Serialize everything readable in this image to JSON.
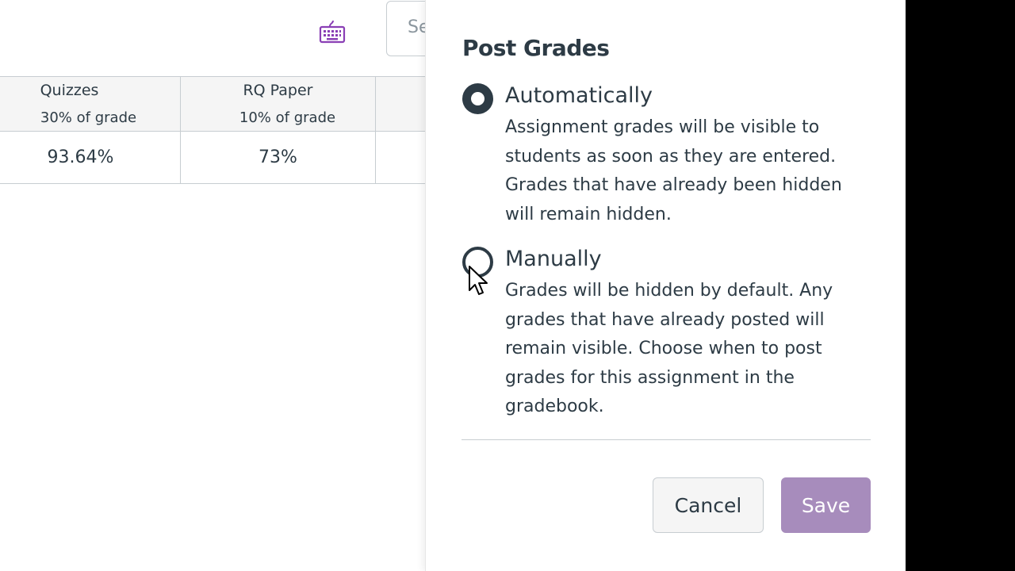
{
  "gradebook": {
    "search": {
      "placeholder": "Search"
    },
    "columns": [
      {
        "name": "Quizzes",
        "weight": "30% of grade",
        "value": "93.64%"
      },
      {
        "name": "RQ Paper",
        "weight": "10% of grade",
        "value": "73%"
      }
    ]
  },
  "tray": {
    "title": "Post Grades",
    "options": [
      {
        "label": "Automatically",
        "selected": true,
        "description": "Assignment grades will be visible to students as soon as they are entered. Grades that have already been hidden will remain hidden."
      },
      {
        "label": "Manually",
        "selected": false,
        "description": "Grades will be hidden by default. Any grades that have already posted will remain visible. Choose when to post grades for this assignment in the gradebook."
      }
    ],
    "cancel_label": "Cancel",
    "save_label": "Save"
  },
  "colors": {
    "text": "#2d3b45",
    "accent_purple": "#a78cbc",
    "keyboard_icon": "#8a3fb5",
    "border": "#c7cdd1"
  },
  "icons": {
    "keyboard": "keyboard-icon",
    "cursor": "mouse-pointer"
  }
}
